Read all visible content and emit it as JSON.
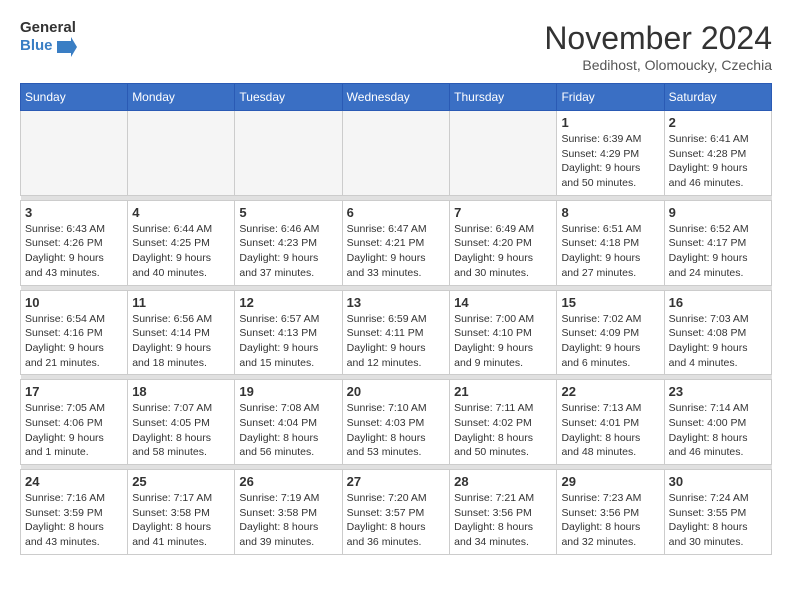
{
  "header": {
    "logo_line1": "General",
    "logo_line2": "Blue",
    "month": "November 2024",
    "location": "Bedihost, Olomoucky, Czechia"
  },
  "days_of_week": [
    "Sunday",
    "Monday",
    "Tuesday",
    "Wednesday",
    "Thursday",
    "Friday",
    "Saturday"
  ],
  "weeks": [
    [
      {
        "day": "",
        "info": ""
      },
      {
        "day": "",
        "info": ""
      },
      {
        "day": "",
        "info": ""
      },
      {
        "day": "",
        "info": ""
      },
      {
        "day": "",
        "info": ""
      },
      {
        "day": "1",
        "info": "Sunrise: 6:39 AM\nSunset: 4:29 PM\nDaylight: 9 hours\nand 50 minutes."
      },
      {
        "day": "2",
        "info": "Sunrise: 6:41 AM\nSunset: 4:28 PM\nDaylight: 9 hours\nand 46 minutes."
      }
    ],
    [
      {
        "day": "3",
        "info": "Sunrise: 6:43 AM\nSunset: 4:26 PM\nDaylight: 9 hours\nand 43 minutes."
      },
      {
        "day": "4",
        "info": "Sunrise: 6:44 AM\nSunset: 4:25 PM\nDaylight: 9 hours\nand 40 minutes."
      },
      {
        "day": "5",
        "info": "Sunrise: 6:46 AM\nSunset: 4:23 PM\nDaylight: 9 hours\nand 37 minutes."
      },
      {
        "day": "6",
        "info": "Sunrise: 6:47 AM\nSunset: 4:21 PM\nDaylight: 9 hours\nand 33 minutes."
      },
      {
        "day": "7",
        "info": "Sunrise: 6:49 AM\nSunset: 4:20 PM\nDaylight: 9 hours\nand 30 minutes."
      },
      {
        "day": "8",
        "info": "Sunrise: 6:51 AM\nSunset: 4:18 PM\nDaylight: 9 hours\nand 27 minutes."
      },
      {
        "day": "9",
        "info": "Sunrise: 6:52 AM\nSunset: 4:17 PM\nDaylight: 9 hours\nand 24 minutes."
      }
    ],
    [
      {
        "day": "10",
        "info": "Sunrise: 6:54 AM\nSunset: 4:16 PM\nDaylight: 9 hours\nand 21 minutes."
      },
      {
        "day": "11",
        "info": "Sunrise: 6:56 AM\nSunset: 4:14 PM\nDaylight: 9 hours\nand 18 minutes."
      },
      {
        "day": "12",
        "info": "Sunrise: 6:57 AM\nSunset: 4:13 PM\nDaylight: 9 hours\nand 15 minutes."
      },
      {
        "day": "13",
        "info": "Sunrise: 6:59 AM\nSunset: 4:11 PM\nDaylight: 9 hours\nand 12 minutes."
      },
      {
        "day": "14",
        "info": "Sunrise: 7:00 AM\nSunset: 4:10 PM\nDaylight: 9 hours\nand 9 minutes."
      },
      {
        "day": "15",
        "info": "Sunrise: 7:02 AM\nSunset: 4:09 PM\nDaylight: 9 hours\nand 6 minutes."
      },
      {
        "day": "16",
        "info": "Sunrise: 7:03 AM\nSunset: 4:08 PM\nDaylight: 9 hours\nand 4 minutes."
      }
    ],
    [
      {
        "day": "17",
        "info": "Sunrise: 7:05 AM\nSunset: 4:06 PM\nDaylight: 9 hours\nand 1 minute."
      },
      {
        "day": "18",
        "info": "Sunrise: 7:07 AM\nSunset: 4:05 PM\nDaylight: 8 hours\nand 58 minutes."
      },
      {
        "day": "19",
        "info": "Sunrise: 7:08 AM\nSunset: 4:04 PM\nDaylight: 8 hours\nand 56 minutes."
      },
      {
        "day": "20",
        "info": "Sunrise: 7:10 AM\nSunset: 4:03 PM\nDaylight: 8 hours\nand 53 minutes."
      },
      {
        "day": "21",
        "info": "Sunrise: 7:11 AM\nSunset: 4:02 PM\nDaylight: 8 hours\nand 50 minutes."
      },
      {
        "day": "22",
        "info": "Sunrise: 7:13 AM\nSunset: 4:01 PM\nDaylight: 8 hours\nand 48 minutes."
      },
      {
        "day": "23",
        "info": "Sunrise: 7:14 AM\nSunset: 4:00 PM\nDaylight: 8 hours\nand 46 minutes."
      }
    ],
    [
      {
        "day": "24",
        "info": "Sunrise: 7:16 AM\nSunset: 3:59 PM\nDaylight: 8 hours\nand 43 minutes."
      },
      {
        "day": "25",
        "info": "Sunrise: 7:17 AM\nSunset: 3:58 PM\nDaylight: 8 hours\nand 41 minutes."
      },
      {
        "day": "26",
        "info": "Sunrise: 7:19 AM\nSunset: 3:58 PM\nDaylight: 8 hours\nand 39 minutes."
      },
      {
        "day": "27",
        "info": "Sunrise: 7:20 AM\nSunset: 3:57 PM\nDaylight: 8 hours\nand 36 minutes."
      },
      {
        "day": "28",
        "info": "Sunrise: 7:21 AM\nSunset: 3:56 PM\nDaylight: 8 hours\nand 34 minutes."
      },
      {
        "day": "29",
        "info": "Sunrise: 7:23 AM\nSunset: 3:56 PM\nDaylight: 8 hours\nand 32 minutes."
      },
      {
        "day": "30",
        "info": "Sunrise: 7:24 AM\nSunset: 3:55 PM\nDaylight: 8 hours\nand 30 minutes."
      }
    ]
  ]
}
